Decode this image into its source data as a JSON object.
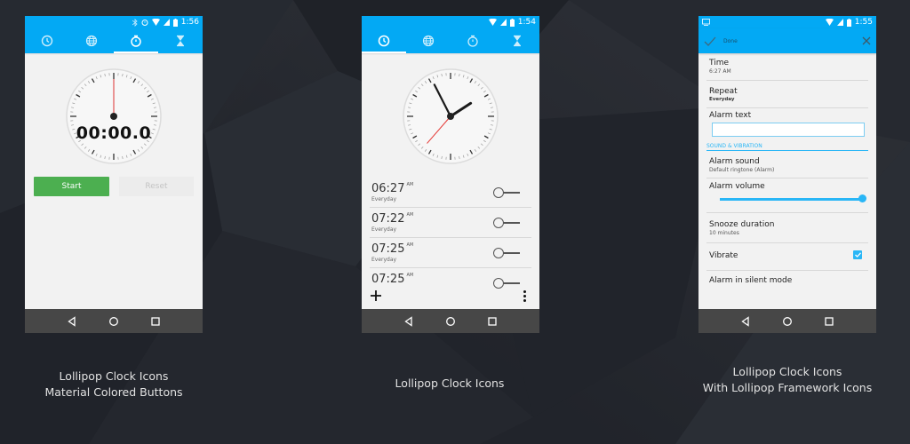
{
  "colors": {
    "primary": "#03a9f4",
    "accent": "#29b6f6",
    "start_button": "#4caf50",
    "second_hand": "#e53935",
    "navbar": "#474747",
    "background": "#23262d"
  },
  "phones": [
    {
      "id": "stopwatch",
      "status_time": "1:56",
      "status_icons": [
        "bluetooth-icon",
        "alarm-icon",
        "wifi-icon",
        "signal-icon",
        "battery-icon"
      ],
      "tabs": [
        {
          "icon": "clock-icon",
          "active": false
        },
        {
          "icon": "globe-icon",
          "active": false
        },
        {
          "icon": "stopwatch-icon",
          "active": true
        },
        {
          "icon": "hourglass-icon",
          "active": false
        }
      ],
      "stopwatch_time": "00:00.0",
      "start_label": "Start",
      "reset_label": "Reset"
    },
    {
      "id": "alarm-clock",
      "status_time": "1:54",
      "status_icons": [
        "wifi-icon",
        "signal-icon",
        "battery-icon"
      ],
      "tabs": [
        {
          "icon": "clock-icon",
          "active": true
        },
        {
          "icon": "globe-icon",
          "active": false
        },
        {
          "icon": "stopwatch-icon",
          "active": false
        },
        {
          "icon": "hourglass-icon",
          "active": false
        }
      ],
      "alarms": [
        {
          "time": "06:27",
          "ampm": "AM",
          "days": "Everyday",
          "enabled": false
        },
        {
          "time": "07:22",
          "ampm": "AM",
          "days": "Everyday",
          "enabled": false
        },
        {
          "time": "07:25",
          "ampm": "AM",
          "days": "Everyday",
          "enabled": false
        },
        {
          "time": "07:25",
          "ampm": "AM",
          "days": "",
          "enabled": false
        }
      ]
    },
    {
      "id": "alarm-settings",
      "status_time": "1:55",
      "status_icons": [
        "wifi-icon",
        "signal-icon",
        "battery-icon"
      ],
      "done_label": "Done",
      "settings": {
        "time_title": "Time",
        "time_value": "6:27 AM",
        "repeat_title": "Repeat",
        "repeat_value": "Everyday",
        "alarm_text_title": "Alarm text",
        "alarm_text_value": "",
        "section_header": "SOUND & VIBRATION",
        "alarm_sound_title": "Alarm sound",
        "alarm_sound_value": "Default ringtone (Alarm)",
        "alarm_volume_title": "Alarm volume",
        "alarm_volume_percent": 100,
        "snooze_title": "Snooze duration",
        "snooze_value": "10 minutes",
        "vibrate_title": "Vibrate",
        "vibrate_checked": true,
        "silent_mode_title": "Alarm in silent mode"
      }
    }
  ],
  "captions": [
    {
      "line1": "Lollipop Clock Icons",
      "line2": "Material Colored Buttons"
    },
    {
      "line1": "Lollipop Clock Icons",
      "line2": ""
    },
    {
      "line1": "Lollipop Clock Icons",
      "line2": "With Lollipop Framework Icons"
    }
  ]
}
